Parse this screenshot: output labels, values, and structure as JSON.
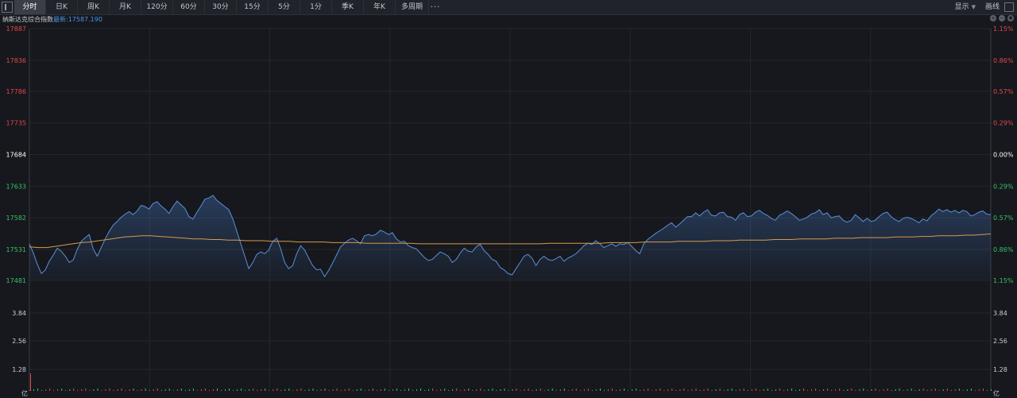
{
  "toolbar": {
    "tabs": [
      "分时",
      "日K",
      "周K",
      "月K",
      "120分",
      "60分",
      "30分",
      "15分",
      "5分",
      "1分",
      "季K",
      "年K",
      "多周期"
    ],
    "active_tab": 0,
    "more_label": "···",
    "display_label": "显示",
    "drawline_label": "画线"
  },
  "info": {
    "title": "纳斯达克综合指数",
    "latest": "最新:17587.190"
  },
  "colors": {
    "up": "#e0484b",
    "down": "#39c16c",
    "neutral": "#ffffff",
    "price_line": "#5b8fd9",
    "avg_line": "#d79a4b",
    "grid": "#23262c"
  },
  "chart_data": {
    "type": "line",
    "price_axis": {
      "ylim": [
        17481,
        17887
      ],
      "ticks": [
        17887,
        17836,
        17786,
        17735,
        17684,
        17633,
        17582,
        17531,
        17481
      ],
      "tick_labels": [
        "17887",
        "17836",
        "17786",
        "17735",
        "17684",
        "17633",
        "17582",
        "17531",
        "17481"
      ],
      "right_labels": [
        "1.15%",
        "0.86%",
        "0.57%",
        "0.29%",
        "0.00%",
        "0.29%",
        "0.57%",
        "0.86%",
        "1.15%"
      ]
    },
    "volume_axis": {
      "ticks": [
        3.84,
        2.56,
        1.28
      ],
      "tick_labels": [
        "3.84",
        "2.56",
        "1.28"
      ],
      "unit": "亿"
    },
    "series": [
      {
        "name": "price",
        "values": [
          17540,
          17525,
          17507,
          17492,
          17498,
          17512,
          17522,
          17533,
          17528,
          17520,
          17510,
          17514,
          17531,
          17544,
          17550,
          17555,
          17532,
          17520,
          17534,
          17548,
          17560,
          17570,
          17576,
          17583,
          17588,
          17592,
          17587,
          17593,
          17602,
          17600,
          17596,
          17605,
          17608,
          17601,
          17596,
          17589,
          17600,
          17609,
          17603,
          17597,
          17584,
          17580,
          17591,
          17601,
          17612,
          17614,
          17618,
          17610,
          17605,
          17600,
          17595,
          17580,
          17560,
          17540,
          17520,
          17500,
          17510,
          17523,
          17527,
          17524,
          17530,
          17544,
          17549,
          17532,
          17510,
          17500,
          17505,
          17524,
          17537,
          17530,
          17517,
          17505,
          17498,
          17499,
          17487,
          17497,
          17509,
          17522,
          17535,
          17541,
          17546,
          17549,
          17545,
          17540,
          17553,
          17555,
          17553,
          17556,
          17562,
          17559,
          17555,
          17558,
          17548,
          17543,
          17544,
          17537,
          17534,
          17532,
          17525,
          17518,
          17513,
          17515,
          17521,
          17527,
          17524,
          17520,
          17510,
          17515,
          17525,
          17533,
          17528,
          17527,
          17535,
          17539,
          17529,
          17523,
          17515,
          17512,
          17502,
          17498,
          17492,
          17490,
          17500,
          17510,
          17520,
          17523,
          17517,
          17505,
          17515,
          17520,
          17515,
          17513,
          17516,
          17520,
          17512,
          17517,
          17520,
          17524,
          17530,
          17537,
          17541,
          17539,
          17545,
          17540,
          17534,
          17537,
          17540,
          17536,
          17540,
          17539,
          17542,
          17536,
          17529,
          17524,
          17540,
          17547,
          17552,
          17557,
          17561,
          17565,
          17570,
          17574,
          17567,
          17572,
          17578,
          17584,
          17584,
          17590,
          17585,
          17591,
          17595,
          17586,
          17585,
          17590,
          17591,
          17584,
          17583,
          17578,
          17587,
          17590,
          17584,
          17585,
          17591,
          17594,
          17589,
          17586,
          17581,
          17578,
          17586,
          17589,
          17593,
          17589,
          17584,
          17578,
          17580,
          17583,
          17588,
          17590,
          17595,
          17587,
          17590,
          17582,
          17584,
          17585,
          17578,
          17575,
          17578,
          17587,
          17582,
          17576,
          17581,
          17576,
          17578,
          17584,
          17589,
          17591,
          17584,
          17579,
          17576,
          17581,
          17583,
          17581,
          17578,
          17574,
          17580,
          17577,
          17585,
          17590,
          17596,
          17592,
          17595,
          17591,
          17594,
          17590,
          17594,
          17592,
          17585,
          17587,
          17591,
          17593,
          17588,
          17587
        ]
      },
      {
        "name": "average",
        "values": [
          17535,
          17534,
          17534,
          17536,
          17538,
          17540,
          17542,
          17543,
          17545,
          17547,
          17549,
          17551,
          17552,
          17553,
          17553,
          17552,
          17551,
          17550,
          17549,
          17548,
          17548,
          17547,
          17547,
          17546,
          17546,
          17545,
          17545,
          17545,
          17544,
          17544,
          17544,
          17543,
          17543,
          17543,
          17543,
          17542,
          17542,
          17542,
          17542,
          17541,
          17541,
          17541,
          17541,
          17541,
          17541,
          17540,
          17540,
          17540,
          17540,
          17540,
          17540,
          17540,
          17540,
          17540,
          17540,
          17540,
          17540,
          17540,
          17540,
          17540,
          17541,
          17541,
          17541,
          17541,
          17541,
          17541,
          17541,
          17542,
          17542,
          17542,
          17542,
          17543,
          17543,
          17543,
          17543,
          17544,
          17544,
          17544,
          17544,
          17545,
          17545,
          17545,
          17546,
          17546,
          17546,
          17546,
          17547,
          17547,
          17547,
          17548,
          17548,
          17548,
          17548,
          17549,
          17549,
          17549,
          17550,
          17550,
          17550,
          17550,
          17551,
          17551,
          17551,
          17552,
          17552,
          17553,
          17553,
          17553,
          17554,
          17554,
          17555,
          17556
        ]
      }
    ]
  }
}
